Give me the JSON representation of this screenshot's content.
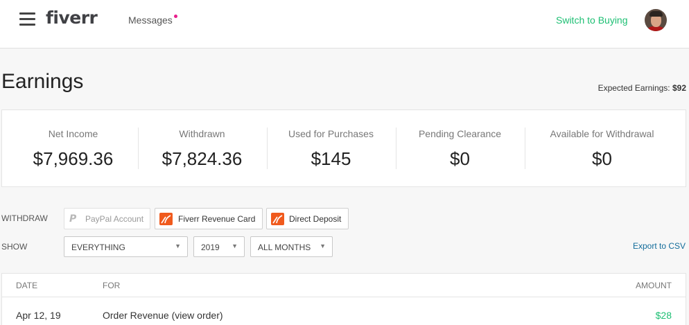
{
  "header": {
    "logo": "fiverr",
    "messages_label": "Messages",
    "switch_label": "Switch to Buying"
  },
  "page": {
    "title": "Earnings",
    "expected_label": "Expected Earnings:",
    "expected_value": "$92"
  },
  "stats": [
    {
      "label": "Net Income",
      "value": "$7,969.36"
    },
    {
      "label": "Withdrawn",
      "value": "$7,824.36"
    },
    {
      "label": "Used for Purchases",
      "value": "$145"
    },
    {
      "label": "Pending Clearance",
      "value": "$0"
    },
    {
      "label": "Available for Withdrawal",
      "value": "$0"
    }
  ],
  "withdraw": {
    "label": "WITHDRAW",
    "buttons": [
      {
        "label": "PayPal Account",
        "icon": "paypal-icon",
        "disabled": true
      },
      {
        "label": "Fiverr Revenue Card",
        "icon": "fiverr-card-icon"
      },
      {
        "label": "Direct Deposit",
        "icon": "direct-deposit-icon"
      }
    ]
  },
  "filters": {
    "label": "SHOW",
    "type_value": "EVERYTHING",
    "year_value": "2019",
    "month_value": "ALL MONTHS",
    "export_label": "Export to CSV"
  },
  "table": {
    "headers": {
      "date": "DATE",
      "for": "FOR",
      "amount": "AMOUNT"
    },
    "rows": [
      {
        "date": "Apr 12, 19",
        "for": "Order Revenue",
        "link": "(view order)",
        "amount": "$28"
      }
    ]
  },
  "colors": {
    "brand_green": "#1dbf73",
    "accent_orange": "#f05a1d",
    "link_blue": "#126c9a",
    "notification_dot": "#e91e8c"
  }
}
